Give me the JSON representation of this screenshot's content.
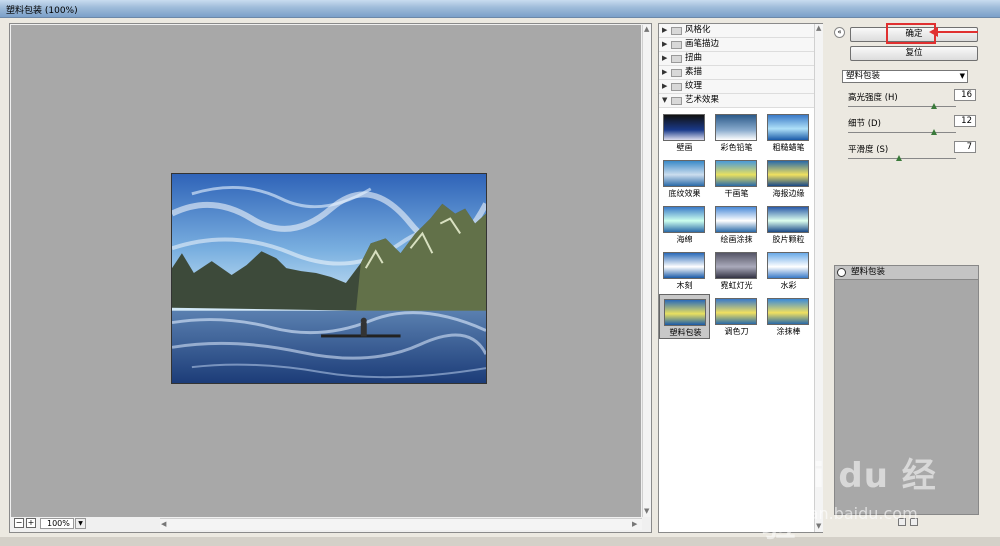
{
  "window": {
    "title": "塑料包装 (100%)"
  },
  "preview": {
    "zoom": "100%",
    "zoom_out": "−",
    "zoom_in": "+"
  },
  "gallery": {
    "categories": [
      {
        "label": "风格化",
        "expanded": false
      },
      {
        "label": "画笔描边",
        "expanded": false
      },
      {
        "label": "扭曲",
        "expanded": false
      },
      {
        "label": "素描",
        "expanded": false
      },
      {
        "label": "纹理",
        "expanded": false
      },
      {
        "label": "艺术效果",
        "expanded": true
      }
    ],
    "filters": [
      "壁画",
      "彩色铅笔",
      "粗糙蜡笔",
      "底纹效果",
      "干画笔",
      "海报边缘",
      "海绵",
      "绘画涂抹",
      "胶片颗粒",
      "木刻",
      "霓虹灯光",
      "水彩",
      "塑料包装",
      "调色刀",
      "涂抹棒"
    ],
    "selected_filter": "塑料包装"
  },
  "settings": {
    "ok_label": "确定",
    "reset_label": "复位",
    "filter_select": "塑料包装",
    "params": [
      {
        "label": "高光强度 (H)",
        "value": "16",
        "fraction": 0.8
      },
      {
        "label": "细节 (D)",
        "value": "12",
        "fraction": 0.8
      },
      {
        "label": "平滑度 (S)",
        "value": "7",
        "fraction": 0.47
      }
    ],
    "layer_label": "塑料包装"
  },
  "watermark": {
    "logo": "Bai du 经验",
    "url": "jingyan.baidu.com"
  }
}
